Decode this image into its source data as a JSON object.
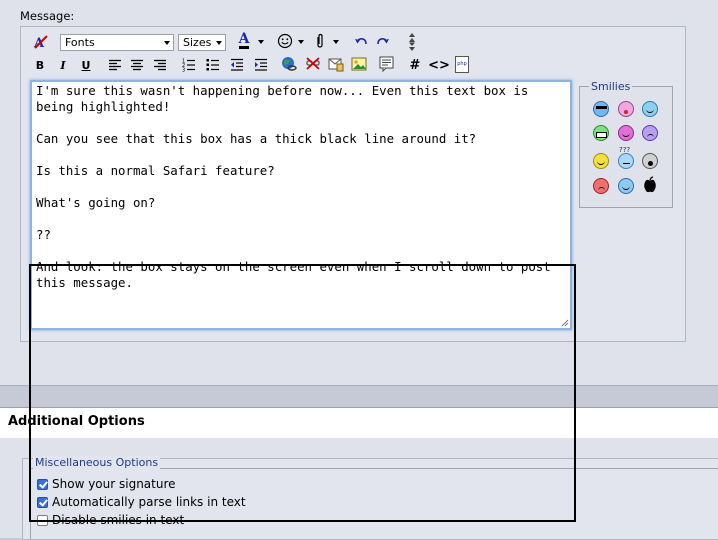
{
  "message": {
    "label": "Message:",
    "toolbar": {
      "fonts_select": "Fonts",
      "sizes_select": "Sizes",
      "font_color_label": "A",
      "bold_label": "B",
      "italic_label": "I",
      "underline_label": "U",
      "code_label": "#",
      "html_label": "<>",
      "php_label": "php"
    },
    "text_lines": [
      "I'm sure this wasn't happening before now... Even this text box is being highlighted!",
      "Can you see that this box has a thick black line around it?",
      "Is this a normal Safari feature?",
      "What's going on?",
      "??",
      "And look: the box stays on the screen even when I scroll down to post this message."
    ]
  },
  "smilies": {
    "legend": "Smilies",
    "more_label": "???"
  },
  "additional_options": {
    "title": "Additional Options",
    "misc_legend": "Miscellaneous Options",
    "options": [
      {
        "label": "Show your signature",
        "checked": true
      },
      {
        "label": "Automatically parse links in text",
        "checked": true
      },
      {
        "label": "Disable smilies in text",
        "checked": false
      }
    ]
  },
  "colors": {
    "focus_ring": "#8fb3df",
    "legend_text": "#1b3b8a",
    "panel_bg": "#dfe2ea"
  }
}
